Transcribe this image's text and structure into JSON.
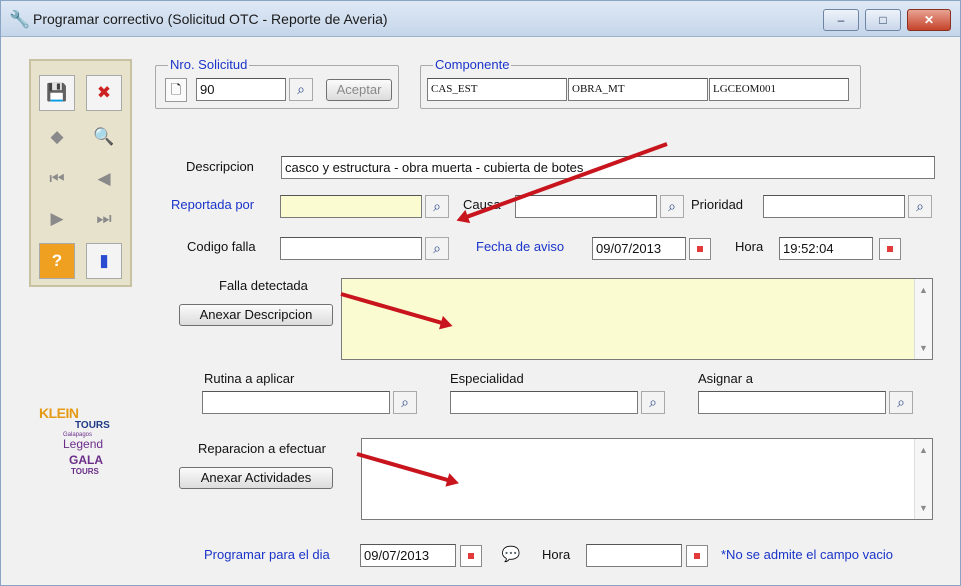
{
  "window": {
    "title": "Programar correctivo (Solicitud OTC - Reporte de Averia)",
    "minimize": "–",
    "maximize": "□",
    "close": "✕"
  },
  "solicitud": {
    "legend": "Nro. Solicitud",
    "value": "90",
    "accept_label": "Aceptar"
  },
  "componente": {
    "legend": "Componente",
    "values": [
      "CAS_EST",
      "OBRA_MT",
      "LGCEOM001"
    ]
  },
  "form": {
    "descripcion_label": "Descripcion",
    "descripcion_value": "casco y estructura - obra muerta - cubierta de botes",
    "reportada_label": "Reportada por",
    "reportada_value": "",
    "causa_label": "Causa",
    "causa_value": "",
    "prioridad_label": "Prioridad",
    "prioridad_value": "",
    "codigo_label": "Codigo falla",
    "codigo_value": "",
    "fecha_aviso_label": "Fecha de aviso",
    "fecha_aviso_value": "09/07/2013",
    "hora_label": "Hora",
    "hora_value": "19:52:04",
    "falla_label": "Falla detectada",
    "anexar_descripcion_label": "Anexar Descripcion",
    "rutina_label": "Rutina a aplicar",
    "especialidad_label": "Especialidad",
    "asignar_label": "Asignar a",
    "reparacion_label": "Reparacion a efectuar",
    "anexar_actividades_label": "Anexar Actividades",
    "programar_label": "Programar para el dia",
    "programar_value": "09/07/2013",
    "hora2_label": "Hora",
    "hora2_value": "",
    "note": "*No se admite el campo vacio"
  },
  "logo": {
    "klein": "KLEIN",
    "tours": "TOURS",
    "galapagos": "Galapagos",
    "legend": "Legend",
    "gala": "GALA",
    "gala_tours": "TOURS"
  },
  "colors": {
    "accent_blue": "#1a34c9",
    "field_yellow": "#fbfbd2",
    "arrow_red": "#c8141c"
  }
}
